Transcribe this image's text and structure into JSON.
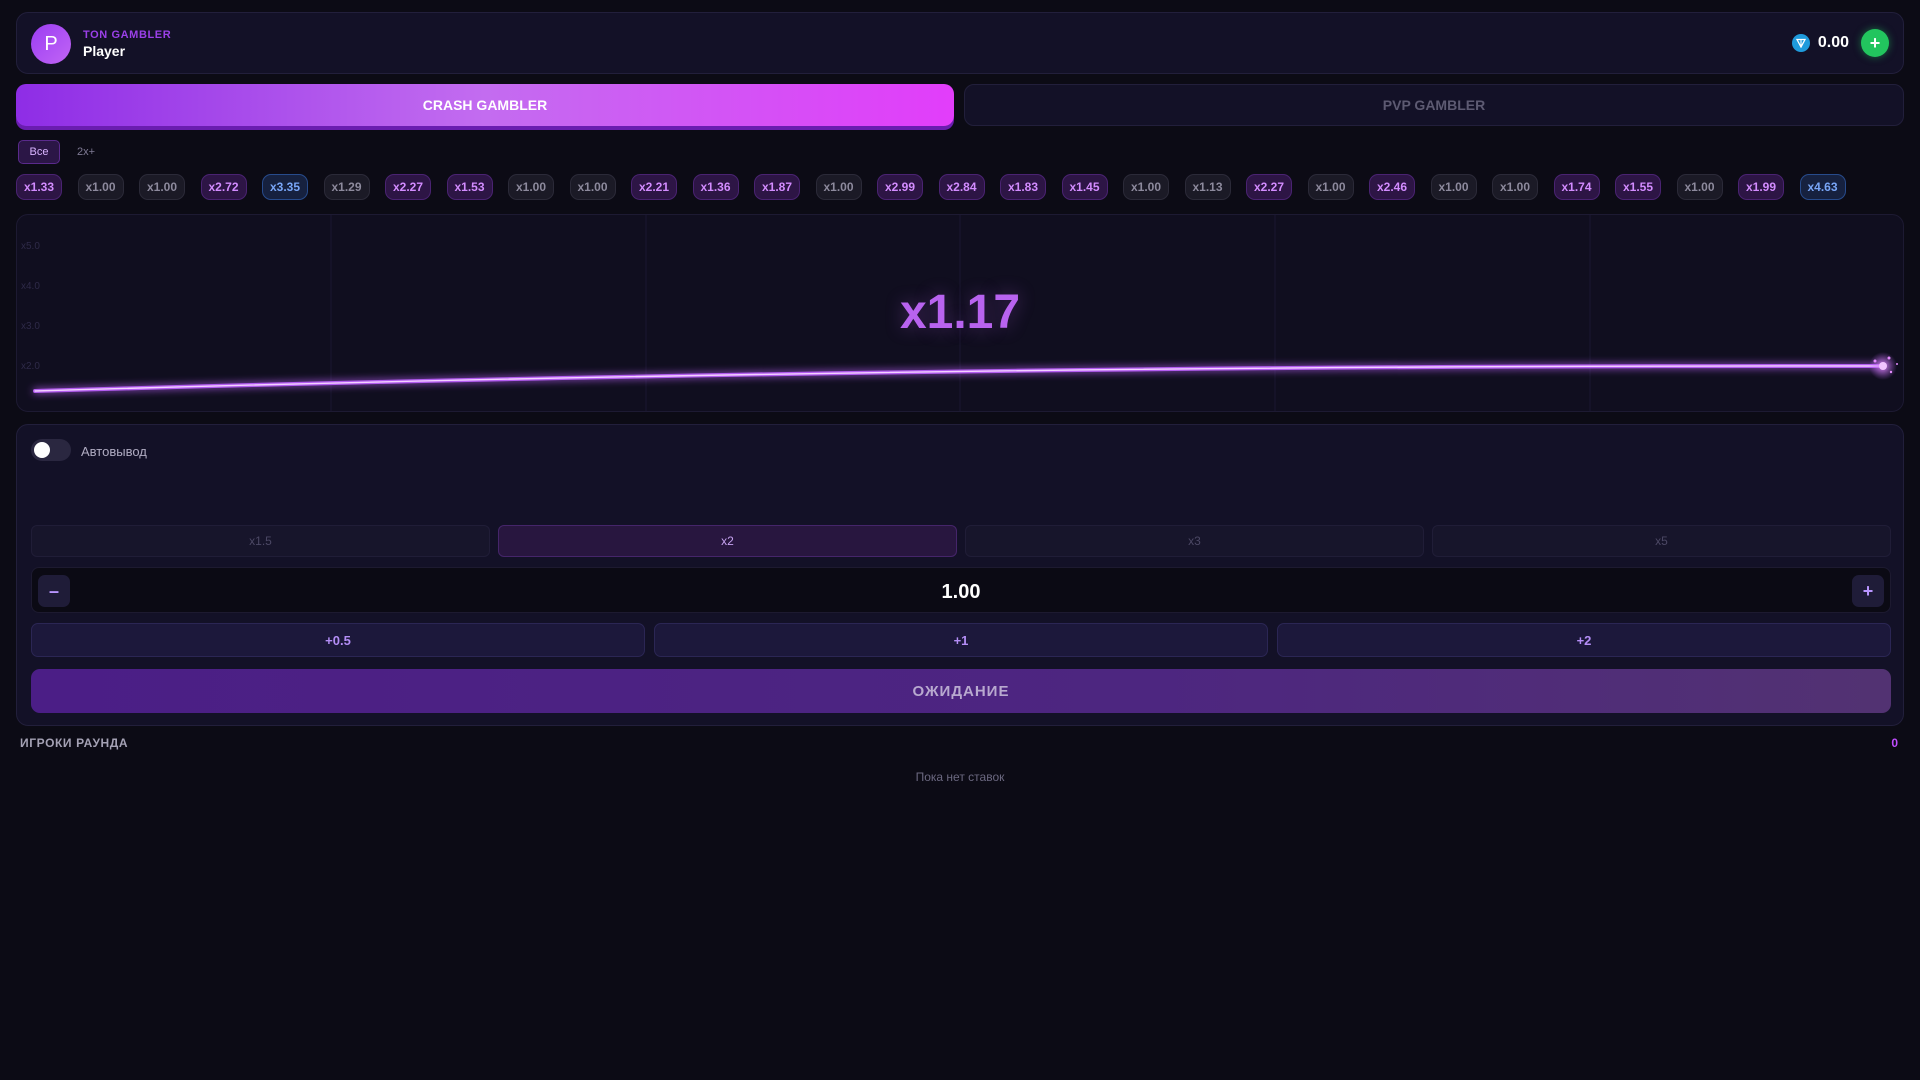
{
  "header": {
    "avatar_letter": "P",
    "brand": "TON GAMBLER",
    "username": "Player",
    "balance": "0.00",
    "add_label": "+"
  },
  "tabs": {
    "crash": "CRASH GAMBLER",
    "pvp": "PVP GAMBLER"
  },
  "filters": {
    "all": "Все",
    "two_x": "2x+"
  },
  "history": [
    {
      "label": "x1.33",
      "tier": "mid"
    },
    {
      "label": "x1.00",
      "tier": "low"
    },
    {
      "label": "x1.00",
      "tier": "low"
    },
    {
      "label": "x2.72",
      "tier": "mid"
    },
    {
      "label": "x3.35",
      "tier": "high"
    },
    {
      "label": "x1.29",
      "tier": "low"
    },
    {
      "label": "x2.27",
      "tier": "mid"
    },
    {
      "label": "x1.53",
      "tier": "mid"
    },
    {
      "label": "x1.00",
      "tier": "low"
    },
    {
      "label": "x1.00",
      "tier": "low"
    },
    {
      "label": "x2.21",
      "tier": "mid"
    },
    {
      "label": "x1.36",
      "tier": "mid"
    },
    {
      "label": "x1.87",
      "tier": "mid"
    },
    {
      "label": "x1.00",
      "tier": "low"
    },
    {
      "label": "x2.99",
      "tier": "mid"
    },
    {
      "label": "x2.84",
      "tier": "mid"
    },
    {
      "label": "x1.83",
      "tier": "mid"
    },
    {
      "label": "x1.45",
      "tier": "mid"
    },
    {
      "label": "x1.00",
      "tier": "low"
    },
    {
      "label": "x1.13",
      "tier": "low"
    },
    {
      "label": "x2.27",
      "tier": "mid"
    },
    {
      "label": "x1.00",
      "tier": "low"
    },
    {
      "label": "x2.46",
      "tier": "mid"
    },
    {
      "label": "x1.00",
      "tier": "low"
    },
    {
      "label": "x1.00",
      "tier": "low"
    },
    {
      "label": "x1.74",
      "tier": "mid"
    },
    {
      "label": "x1.55",
      "tier": "mid"
    },
    {
      "label": "x1.00",
      "tier": "low"
    },
    {
      "label": "x1.99",
      "tier": "mid"
    },
    {
      "label": "x4.63",
      "tier": "high"
    }
  ],
  "game": {
    "multiplier": "x1.17",
    "y_labels": [
      "x5.0",
      "x4.0",
      "x3.0",
      "x2.0"
    ]
  },
  "bet": {
    "auto_label": "Автовывод",
    "auto_enabled": false,
    "presets": [
      "x1.5",
      "x2",
      "x3",
      "x5"
    ],
    "active_preset": "x2",
    "minus": "–",
    "amount": "1.00",
    "plus": "+",
    "increments": [
      "+0.5",
      "+1",
      "+2"
    ],
    "action_label": "ОЖИДАНИЕ"
  },
  "players": {
    "title": "ИГРОКИ РАУНДА",
    "count": "0",
    "empty_text": "Пока нет ставок"
  },
  "colors": {
    "accent": "#b863ef",
    "background": "#0c0b15",
    "panel": "#131127",
    "add_button": "#22c55e"
  }
}
